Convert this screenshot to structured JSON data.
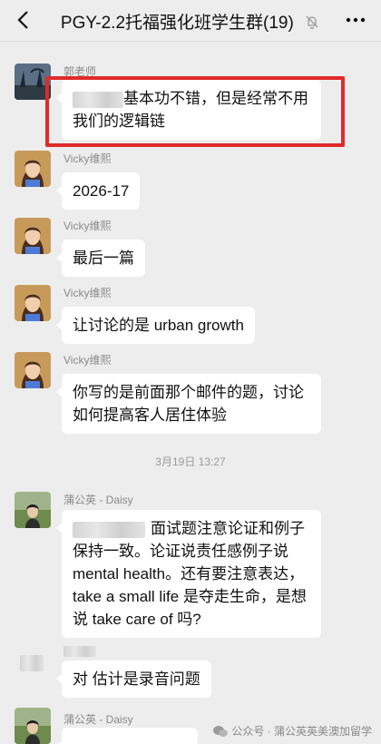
{
  "header": {
    "title": "PGY-2.2托福强化班学生群(19)",
    "back_icon": "chevron-left-icon",
    "mute_icon": "bell-off-icon",
    "more_icon": "more-horizontal-icon"
  },
  "messages": [
    {
      "sender": "郭老师",
      "text": "基本功不错，但是经常不用我们的逻辑链",
      "line1": "基本功不错，但是经常不用",
      "line2": "我们的逻辑链"
    },
    {
      "sender": "Vicky维熙",
      "text": "2026-17"
    },
    {
      "sender": "Vicky维熙",
      "text": "最后一篇"
    },
    {
      "sender": "Vicky维熙",
      "text": "让讨论的是 urban growth"
    },
    {
      "sender": "Vicky维熙",
      "line1": "你写的是前面那个邮件的题，讨论",
      "line2": "如何提高客人居住体验"
    },
    {
      "sender": "蒲公英 - Daisy",
      "line1": "面试题注意论证和例子",
      "line2": "保持一致。论证说责任感例子说",
      "line3": "mental health。还有要注意表达，",
      "line4": "take a small life 是夺走生命，是想",
      "line5": "说 take care of 吗?"
    },
    {
      "sender": "",
      "text": "对 估计是录音问题"
    },
    {
      "sender": "蒲公英 - Daisy",
      "text": ""
    }
  ],
  "timestamp": "3月19日 13:27",
  "watermark": "公众号 · 蒲公英英美澳加留学",
  "colors": {
    "highlight": "#e02a2a",
    "background": "#ededed",
    "bubble": "#ffffff"
  }
}
